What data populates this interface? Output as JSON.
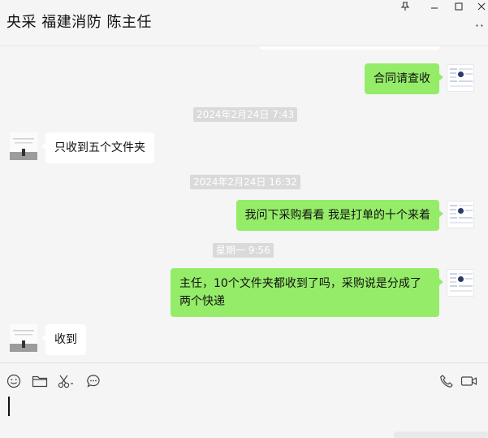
{
  "window": {
    "title": "央采 福建消防 陈主任"
  },
  "messages": [
    {
      "dir": "out",
      "text": "合同请查收"
    },
    {
      "dir": "in",
      "text": "只收到五个文件夹"
    },
    {
      "dir": "out",
      "text": "我问下采购看看 我是打单的十个来着"
    },
    {
      "dir": "out",
      "text": "主任，10个文件夹都收到了吗，采购说是分成了两个快递"
    },
    {
      "dir": "in",
      "text": "收到"
    }
  ],
  "timestamps": [
    "2024年2月24日 7:43",
    "2024年2月24日 16:32",
    "星期一 9:56"
  ],
  "toolbar": {
    "icons": [
      "emoji-icon",
      "folder-icon",
      "scissors-icon",
      "chat-history-icon",
      "phone-icon",
      "video-icon"
    ]
  },
  "colors": {
    "outgoing_bubble": "#95ec69",
    "incoming_bubble": "#ffffff",
    "background": "#f5f5f5"
  }
}
